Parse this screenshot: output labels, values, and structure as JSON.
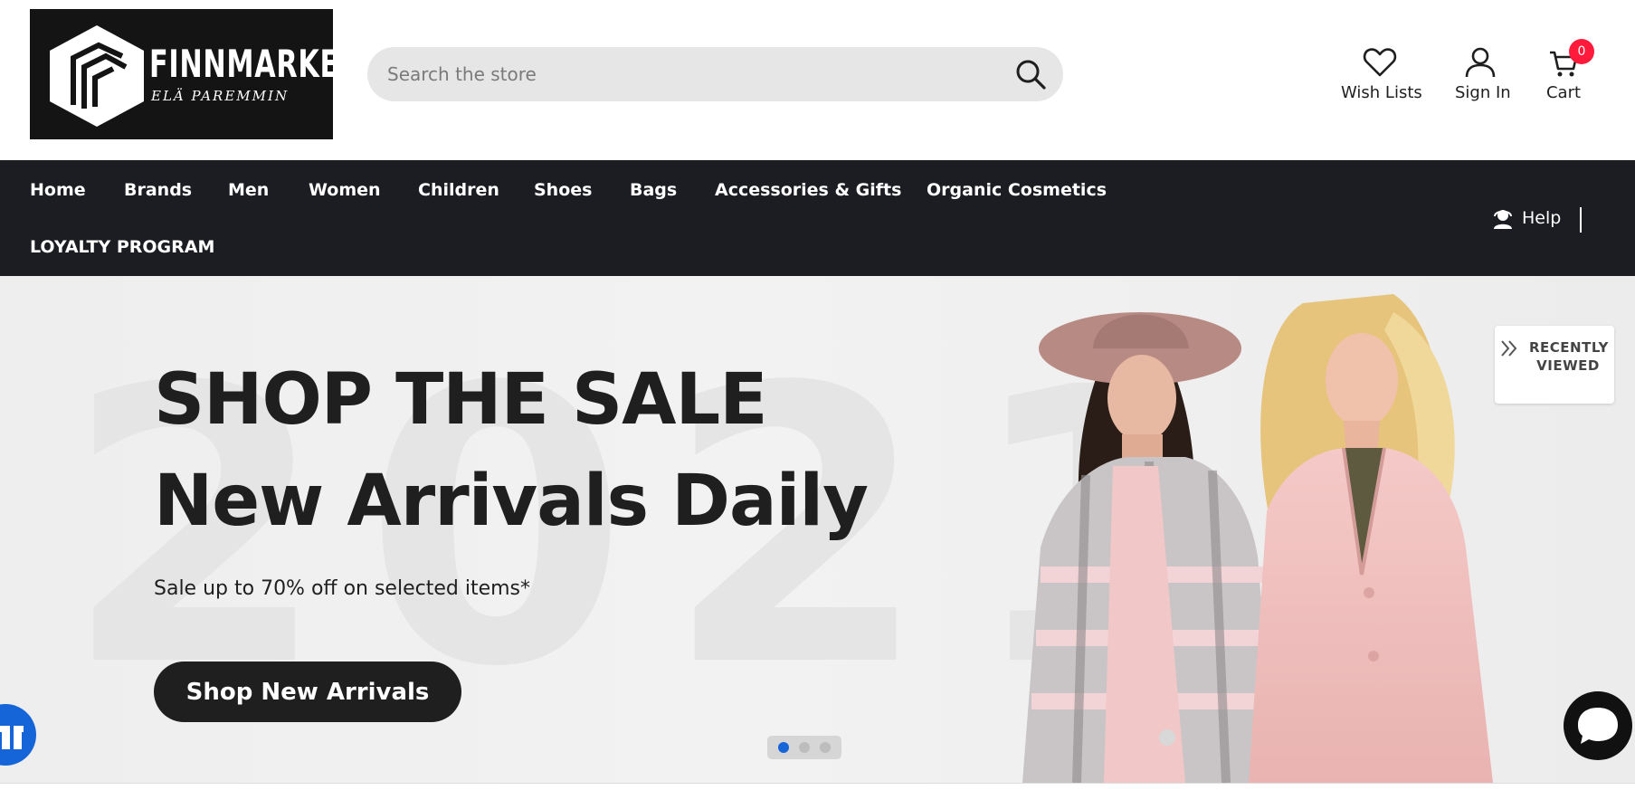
{
  "brand": {
    "name": "FINNMARKET",
    "tagline": "ELÄ PAREMMIN"
  },
  "search": {
    "placeholder": "Search the store"
  },
  "header_actions": {
    "wish_lists": "Wish Lists",
    "sign_in": "Sign In",
    "cart": "Cart",
    "cart_count": "0"
  },
  "nav": {
    "items": [
      "Home",
      "Brands",
      "Men",
      "Women",
      "Children",
      "Shoes",
      "Bags",
      "Accessories & Gifts",
      "Organic Cosmetics",
      "LOYALTY PROGRAM"
    ],
    "help": "Help"
  },
  "hero": {
    "title": "SHOP THE SALE",
    "subtitle": "New Arrivals Daily",
    "description": "Sale up to 70% off on selected items*",
    "button": "Shop New Arrivals",
    "background_text": "2021",
    "slides": 3,
    "active_slide": 1
  },
  "recently_viewed": {
    "label": "RECENTLY VIEWED"
  },
  "colors": {
    "nav_bg": "#1c1d22",
    "accent_blue": "#1565d8",
    "cart_badge": "#ff1a3c",
    "button_dark": "#1f1f1f"
  },
  "icons": [
    "search-icon",
    "heart-icon",
    "user-icon",
    "cart-icon",
    "headset-icon",
    "chevron-double-icon",
    "gift-icon",
    "chat-icon"
  ]
}
